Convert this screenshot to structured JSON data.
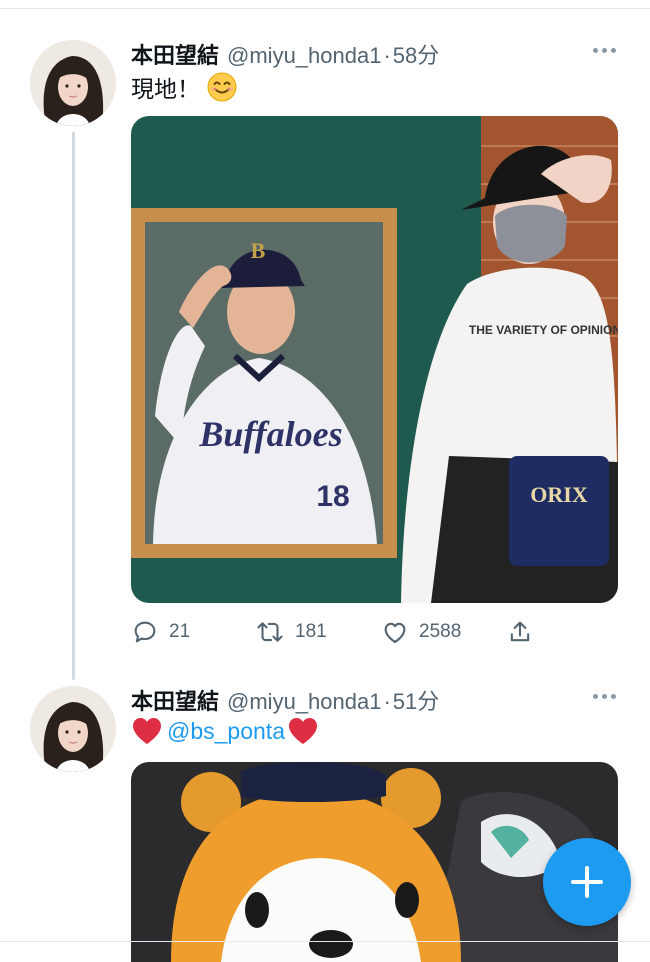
{
  "tweets": [
    {
      "author_name": "本田望結",
      "handle": "@miyu_honda1",
      "separator": "·",
      "time": "58分",
      "text": "現地！",
      "emoji": "smiling-face-emoji",
      "media": "photo-framed-baseball-player-portrait-and-woman-with-orix-jersey-pouch",
      "metrics": {
        "replies": "21",
        "retweets": "181",
        "likes": "2588"
      }
    },
    {
      "author_name": "本田望結",
      "handle": "@miyu_honda1",
      "separator": "·",
      "time": "51分",
      "mention": "@bs_ponta",
      "emoji": "red-heart-emoji",
      "media": "photo-plush-bear-mascot-with-cap"
    }
  ],
  "icons": [
    "more-icon",
    "reply-icon",
    "retweet-icon",
    "like-icon",
    "share-icon",
    "compose-icon"
  ],
  "colors": {
    "accent": "#1d9bf0",
    "secondary_text": "#536471",
    "thread_line": "#cfd9de",
    "heart": "#e0245e"
  }
}
